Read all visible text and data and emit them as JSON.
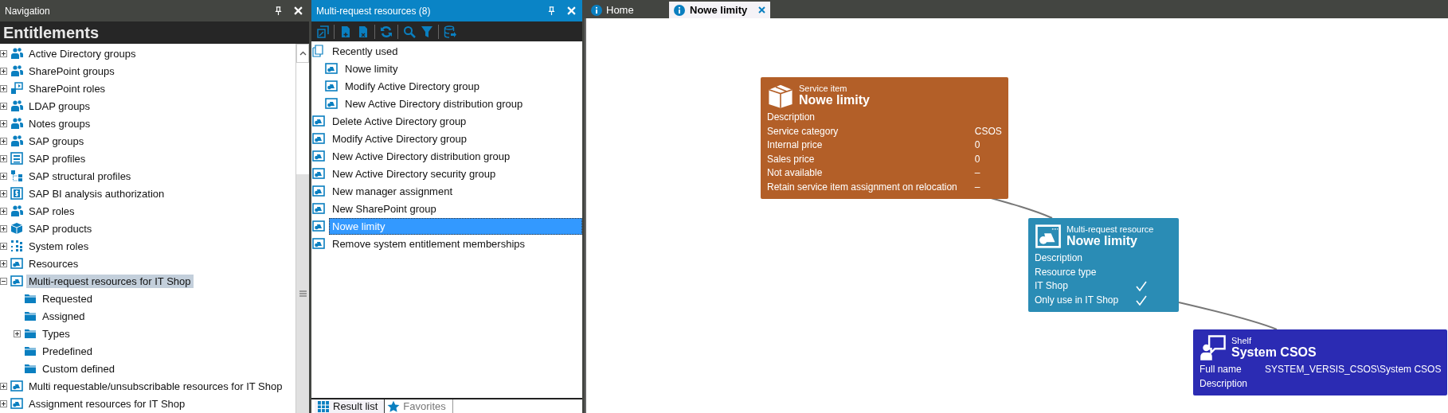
{
  "navigation": {
    "title": "Navigation",
    "section": "Entitlements",
    "tree": [
      {
        "label": "Active Directory groups",
        "kind": "group",
        "expanded": false,
        "selected": false
      },
      {
        "label": "SharePoint groups",
        "kind": "group",
        "expanded": false,
        "selected": false
      },
      {
        "label": "SharePoint roles",
        "kind": "role",
        "expanded": false,
        "selected": false
      },
      {
        "label": "LDAP groups",
        "kind": "group",
        "expanded": false,
        "selected": false
      },
      {
        "label": "Notes groups",
        "kind": "group",
        "expanded": false,
        "selected": false
      },
      {
        "label": "SAP groups",
        "kind": "group",
        "expanded": false,
        "selected": false
      },
      {
        "label": "SAP profiles",
        "kind": "profile",
        "expanded": false,
        "selected": false
      },
      {
        "label": "SAP structural profiles",
        "kind": "structure",
        "expanded": false,
        "selected": false
      },
      {
        "label": "SAP BI analysis authorization",
        "kind": "dollar",
        "expanded": false,
        "selected": false
      },
      {
        "label": "SAP roles",
        "kind": "group",
        "expanded": false,
        "selected": false
      },
      {
        "label": "SAP products",
        "kind": "cube",
        "expanded": false,
        "selected": false
      },
      {
        "label": "System roles",
        "kind": "dots",
        "expanded": false,
        "selected": false
      },
      {
        "label": "Resources",
        "kind": "resource",
        "expanded": false,
        "selected": false
      },
      {
        "label": "Multi-request resources for IT Shop",
        "kind": "resource",
        "expanded": true,
        "selected": true,
        "children": [
          {
            "label": "Requested",
            "kind": "folder",
            "selected": false
          },
          {
            "label": "Assigned",
            "kind": "folder",
            "selected": false
          },
          {
            "label": "Types",
            "kind": "folder",
            "expanded": false,
            "selected": false
          },
          {
            "label": "Predefined",
            "kind": "folder",
            "selected": false
          },
          {
            "label": "Custom defined",
            "kind": "folder",
            "selected": false
          }
        ]
      },
      {
        "label": "Multi requestable/unsubscribable resources for IT Shop",
        "kind": "resource",
        "expanded": false,
        "selected": false
      },
      {
        "label": "Assignment resources for IT Shop",
        "kind": "resource",
        "expanded": false,
        "selected": false
      }
    ]
  },
  "results": {
    "title": "Multi-request resources (8)",
    "list": [
      {
        "label": "Recently used",
        "kind": "recent",
        "selected": false,
        "children": [
          {
            "label": "Nowe limity",
            "kind": "resource",
            "selected": false
          },
          {
            "label": "Modify Active Directory group",
            "kind": "resource",
            "selected": false
          },
          {
            "label": "New Active Directory distribution group",
            "kind": "resource",
            "selected": false
          }
        ]
      },
      {
        "label": "Delete Active Directory group",
        "kind": "resource",
        "selected": false
      },
      {
        "label": "Modify Active Directory group",
        "kind": "resource",
        "selected": false
      },
      {
        "label": "New Active Directory distribution group",
        "kind": "resource",
        "selected": false
      },
      {
        "label": "New Active Directory security group",
        "kind": "resource",
        "selected": false
      },
      {
        "label": "New manager assignment",
        "kind": "resource",
        "selected": false
      },
      {
        "label": "New SharePoint group",
        "kind": "resource",
        "selected": false
      },
      {
        "label": "Nowe limity",
        "kind": "resource",
        "selected": true
      },
      {
        "label": "Remove system entitlement memberships",
        "kind": "resource",
        "selected": false
      }
    ],
    "bottom_tabs": [
      {
        "label": "Result list",
        "kind": "grid",
        "selected": true
      },
      {
        "label": "Favorites",
        "kind": "star",
        "selected": false
      }
    ]
  },
  "document_tabs": [
    {
      "label": "Home",
      "selected": false
    },
    {
      "label": "Nowe limity",
      "selected": true
    }
  ],
  "cards": [
    {
      "kind": "service",
      "color": "#b35f28",
      "type": "Service item",
      "name": "Nowe limity",
      "fields": [
        {
          "kind": "text",
          "label": "Description"
        },
        {
          "kind": "text",
          "label": "Service category",
          "value": "CSOS"
        },
        {
          "kind": "text",
          "label": "Internal price",
          "value": "0"
        },
        {
          "kind": "text",
          "label": "Sales price",
          "value": "0"
        },
        {
          "kind": "text",
          "label": "Not available",
          "value": "–"
        },
        {
          "kind": "text",
          "label": "Retain service item assignment on relocation",
          "value": "–"
        }
      ]
    },
    {
      "kind": "resource",
      "color": "#2a8cb5",
      "type": "Multi-request resource",
      "name": "Nowe limity",
      "fields": [
        {
          "kind": "text",
          "label": "Description"
        },
        {
          "kind": "text",
          "label": "Resource type"
        },
        {
          "kind": "check",
          "label": "IT Shop",
          "checked": true
        },
        {
          "kind": "check",
          "label": "Only use in IT Shop",
          "checked": true
        }
      ]
    },
    {
      "kind": "shelf",
      "color": "#2b2bb3",
      "type": "Shelf",
      "name": "System CSOS",
      "fields": [
        {
          "kind": "text",
          "label": "Full name",
          "value": "SYSTEM_VERSIS_CSOS\\System CSOS"
        },
        {
          "kind": "text",
          "label": "Description"
        }
      ]
    }
  ]
}
